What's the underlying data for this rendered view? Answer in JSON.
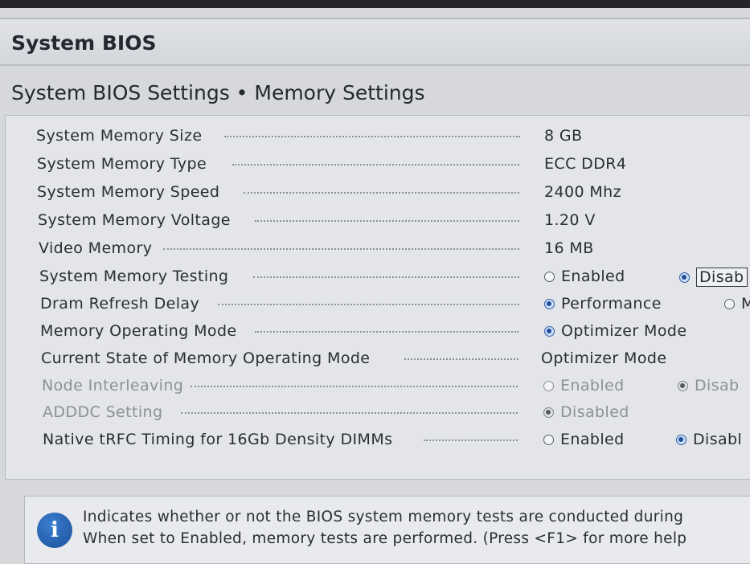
{
  "header": {
    "title": "System BIOS"
  },
  "page": {
    "title": "System BIOS Settings • Memory Settings"
  },
  "settings": [
    {
      "label": "System Memory Size",
      "value": "8 GB"
    },
    {
      "label": "System Memory Type",
      "value": "ECC DDR4"
    },
    {
      "label": "System Memory Speed",
      "value": "2400 Mhz"
    },
    {
      "label": "System Memory Voltage",
      "value": "1.20 V"
    },
    {
      "label": "Video Memory",
      "value": "16 MB"
    },
    {
      "label": "System Memory Testing",
      "options": [
        "Enabled",
        "Disab"
      ],
      "selected": "Disabled"
    },
    {
      "label": "Dram Refresh Delay",
      "options": [
        "Performance",
        "M"
      ],
      "selected": "Performance"
    },
    {
      "label": "Memory Operating Mode",
      "options": [
        "Optimizer Mode"
      ],
      "selected": "Optimizer Mode"
    },
    {
      "label": "Current State of Memory Operating Mode",
      "value": "Optimizer Mode"
    },
    {
      "label": "Node Interleaving",
      "options": [
        "Enabled",
        "Disab"
      ],
      "selected": "Disabled",
      "disabled": true
    },
    {
      "label": "ADDDC Setting",
      "options": [
        "Disabled"
      ],
      "selected": "Disabled",
      "disabled": true
    },
    {
      "label": "Native tRFC Timing for 16Gb Density DIMMs",
      "options": [
        "Enabled",
        "Disabl"
      ],
      "selected": "Disabled"
    }
  ],
  "help": {
    "icon": "info-icon",
    "line1": "Indicates whether or not the BIOS system memory tests are conducted during",
    "line2": "When set to Enabled, memory tests are performed. (Press <F1> for more help"
  },
  "colors": {
    "accent": "#1f4f9a",
    "background": "#d6d8dc"
  }
}
